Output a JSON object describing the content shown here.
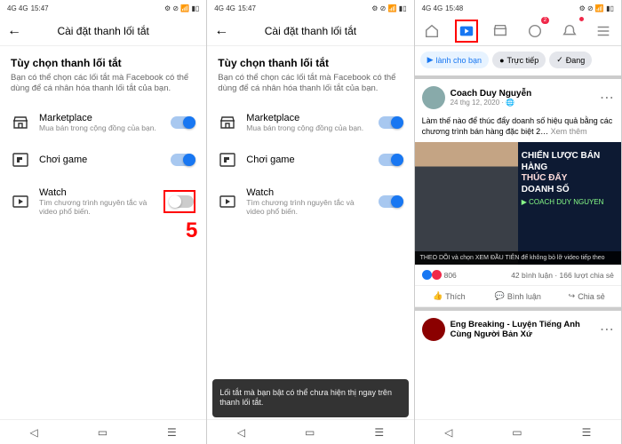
{
  "status": {
    "time1": "15:47",
    "time2": "15:48",
    "sig": "4G 4G",
    "right": "⚙ ⊘ 📶 ▮▯"
  },
  "settings": {
    "title": "Cài đặt thanh lối tắt",
    "section_title": "Tùy chọn thanh lối tắt",
    "section_sub": "Bạn có thể chọn các lối tắt mà Facebook có thể dùng để cá nhân hóa thanh lối tắt của bạn.",
    "opts": [
      {
        "title": "Marketplace",
        "sub": "Mua bán trong cộng đồng của bạn."
      },
      {
        "title": "Chơi game",
        "sub": ""
      },
      {
        "title": "Watch",
        "sub": "Tìm chương trình nguyên tắc và video phổ biến."
      }
    ],
    "toast": "Lối tắt mà bạn bật có thể chưa hiện thị ngay trên thanh lối tắt."
  },
  "callout": "5",
  "feed": {
    "chips": [
      "lành cho bạn",
      "Trực tiếp",
      "Đang"
    ],
    "post1": {
      "author": "Coach Duy Nguyễn",
      "meta": "24 thg 12, 2020 · 🌐",
      "text": "Làm thế nào để thúc đẩy doanh số hiệu quả bằng các chương trình bán hàng đặc biệt 2…",
      "seemore": "Xem thêm",
      "video_title_line1": "CHIẾN LƯỢC BÁN HÀNG",
      "video_title_line2": "THÚC ĐẨY",
      "video_title_line3": "DOANH SỐ",
      "video_by": "▶ COACH DUY NGUYEN",
      "bar": "THEO DÕI và chọn XEM ĐẦU TIÊN để không bỏ lỡ video tiếp theo",
      "likes": "806",
      "comments": "42 bình luận · 166 lượt chia sẻ",
      "act_like": "Thích",
      "act_comment": "Bình luận",
      "act_share": "Chia sẻ"
    },
    "post2": {
      "author": "Eng Breaking - Luyện Tiếng Anh Cùng Người Bản Xứ"
    },
    "tab_badges": {
      "groups": "2"
    }
  }
}
